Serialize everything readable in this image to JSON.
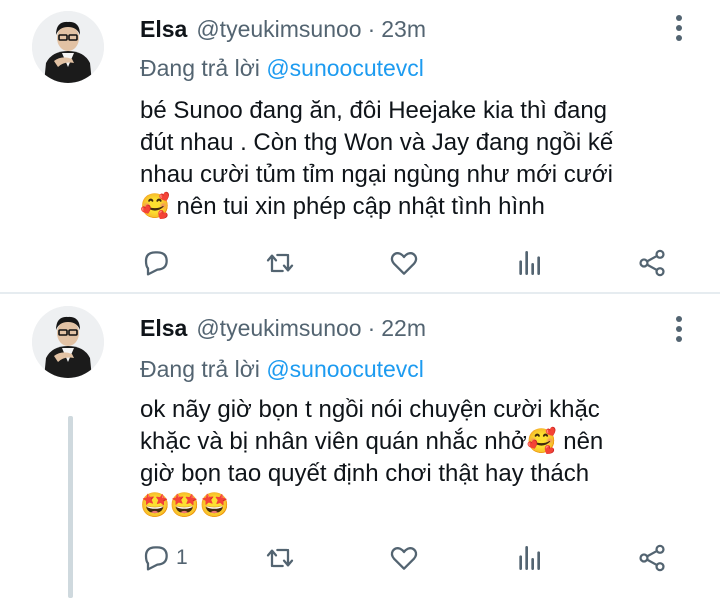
{
  "tweets": [
    {
      "name": "Elsa",
      "handle": "@tyeukimsunoo",
      "separator": "·",
      "time": "23m",
      "reply_prefix": "Đang trả lời",
      "reply_mention": "@sunoocutevcl",
      "text_lines": [
        "bé Sunoo đang ăn, đôi Heejake kia thì đang",
        "đút nhau . Còn thg Won và Jay đang ngồi kế",
        "nhau cười tủm tỉm ngại ngùng như mới cưới",
        "🥰 nên tui xin phép cập nhật tình hình"
      ],
      "reply_count": ""
    },
    {
      "name": "Elsa",
      "handle": "@tyeukimsunoo",
      "separator": "·",
      "time": "22m",
      "reply_prefix": "Đang trả lời",
      "reply_mention": "@sunoocutevcl",
      "text_lines": [
        "ok nãy giờ bọn t ngồi nói chuyện cười khặc",
        "khặc và bị nhân viên quán nhắc nhở🥰 nên",
        "giờ bọn tao quyết định chơi thật hay thách",
        "🤩🤩🤩"
      ],
      "reply_count": "1"
    }
  ],
  "icons": [
    "reply-icon",
    "retweet-icon",
    "like-icon",
    "stats-icon",
    "share-icon",
    "more-icon"
  ],
  "colors": {
    "text": "#0f1419",
    "secondary": "#536471",
    "link": "#1d9bf0",
    "divider": "#e6ecf0",
    "thread": "#cfd9de"
  }
}
